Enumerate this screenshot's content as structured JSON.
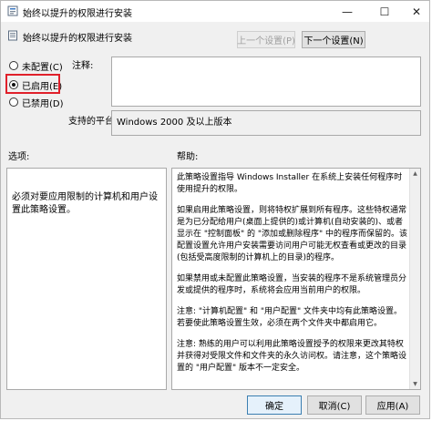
{
  "window": {
    "title": "始终以提升的权限进行安装",
    "minimize_glyph": "—",
    "maximize_glyph": "☐",
    "close_glyph": "✕"
  },
  "header": {
    "policy_title": "始终以提升的权限进行安装",
    "prev_label": "上一个设置(P)",
    "next_label": "下一个设置(N)"
  },
  "state": {
    "options": [
      {
        "label": "未配置(C)",
        "checked": false
      },
      {
        "label": "已启用(E)",
        "checked": true
      },
      {
        "label": "已禁用(D)",
        "checked": false
      }
    ],
    "highlight_color": "#e0202a"
  },
  "comment": {
    "label": "注释:",
    "value": ""
  },
  "platform": {
    "label": "支持的平台:",
    "value": "Windows 2000 及以上版本"
  },
  "options_section": {
    "label": "选项:",
    "text": "必须对要应用限制的计算机和用户设置此策略设置。"
  },
  "help_section": {
    "label": "帮助:",
    "paragraphs": [
      "此策略设置指导 Windows Installer 在系统上安装任何程序时使用提升的权限。",
      "如果启用此策略设置，则将特权扩展到所有程序。这些特权通常是为已分配给用户(桌面上提供的)或计算机(自动安装的)、或者显示在 \"控制面板\" 的 \"添加或删除程序\" 中的程序而保留的。该配置设置允许用户安装需要访问用户可能无权查看或更改的目录(包括受高度限制的计算机上的目录)的程序。",
      "如果禁用或未配置此策略设置，当安装的程序不是系统管理员分发或提供的程序时，系统将会应用当前用户的权限。",
      "注意: \"计算机配置\" 和 \"用户配置\" 文件夹中均有此策略设置。若要使此策略设置生效，必须在两个文件夹中都启用它。",
      "注意: 熟练的用户可以利用此策略设置授予的权限来更改其特权并获得对受限文件和文件夹的永久访问权。请注意，这个策略设置的 \"用户配置\" 版本不一定安全。"
    ]
  },
  "footer": {
    "ok_label": "确定",
    "cancel_label": "取消(C)",
    "apply_label": "应用(A)"
  }
}
